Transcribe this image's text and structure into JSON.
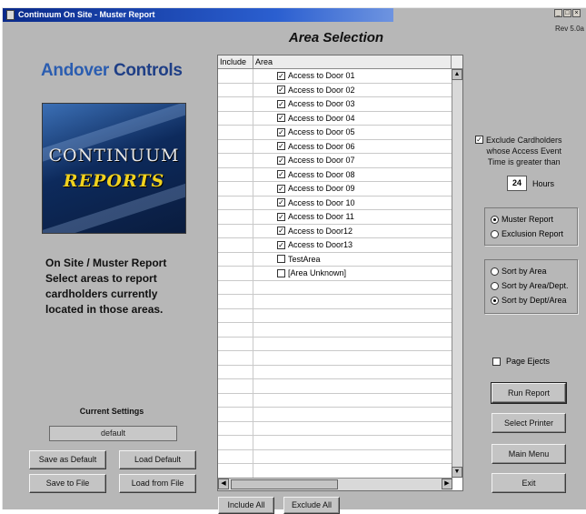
{
  "window": {
    "title": "Continuum On Site - Muster Report",
    "revision": "Rev 5.0a"
  },
  "branding": {
    "company_part1": "Andover",
    "company_part2": "Controls",
    "banner_line1": "CONTINUUM",
    "banner_line2": "REPORTS"
  },
  "description": {
    "line1": "On Site / Muster Report",
    "line2": "Select areas to report",
    "line3": "cardholders currently",
    "line4": "located in those areas."
  },
  "current_settings": {
    "label": "Current Settings",
    "value": "default"
  },
  "left_buttons": {
    "save_default": "Save as Default",
    "load_default": "Load Default",
    "save_file": "Save to File",
    "load_file": "Load from File"
  },
  "area_selection": {
    "title": "Area Selection",
    "col_include": "Include",
    "col_area": "Area",
    "rows": [
      {
        "checked": true,
        "area": "Access to Door 01"
      },
      {
        "checked": true,
        "area": "Access to Door 02"
      },
      {
        "checked": true,
        "area": "Access to Door 03"
      },
      {
        "checked": true,
        "area": "Access to Door 04"
      },
      {
        "checked": true,
        "area": "Access to Door 05"
      },
      {
        "checked": true,
        "area": "Access to Door 06"
      },
      {
        "checked": true,
        "area": "Access to Door 07"
      },
      {
        "checked": true,
        "area": "Access to Door 08"
      },
      {
        "checked": true,
        "area": "Access to Door 09"
      },
      {
        "checked": true,
        "area": "Access to Door 10"
      },
      {
        "checked": true,
        "area": "Access to Door 11"
      },
      {
        "checked": true,
        "area": "Access to Door12"
      },
      {
        "checked": true,
        "area": "Access to Door13"
      },
      {
        "checked": false,
        "area": "TestArea"
      },
      {
        "checked": false,
        "area": "[Area Unknown]"
      }
    ],
    "empty_rows": 15,
    "include_all": "Include All",
    "exclude_all": "Exclude All"
  },
  "exclude_option": {
    "checked": true,
    "line1": "Exclude Cardholders",
    "line2": "whose Access Event",
    "line3": "Time is greater than",
    "hours_value": "24",
    "hours_label": "Hours"
  },
  "report_type": {
    "muster": "Muster Report",
    "exclusion": "Exclusion Report",
    "selected": "muster"
  },
  "sort_by": {
    "area": "Sort by Area",
    "area_dept": "Sort by Area/Dept.",
    "dept_area": "Sort by Dept/Area",
    "selected": "dept_area"
  },
  "page_ejects": {
    "label": "Page Ejects",
    "checked": false
  },
  "right_buttons": {
    "run_report": "Run Report",
    "select_printer": "Select Printer",
    "main_menu": "Main Menu",
    "exit": "Exit"
  },
  "icons": {
    "check_mark": "✓",
    "radio_selected": "filled-dot"
  }
}
